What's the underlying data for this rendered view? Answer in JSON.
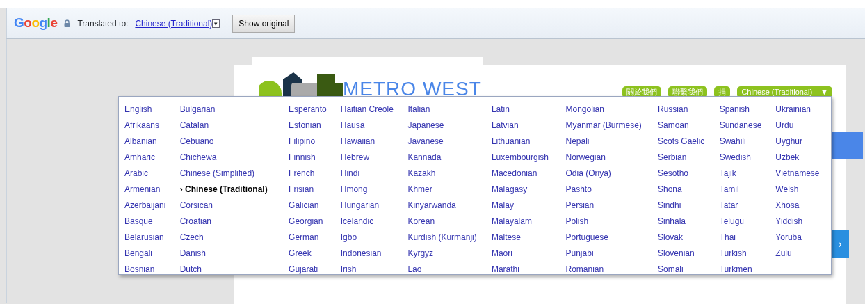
{
  "translate_bar": {
    "brand": "Google",
    "label": "Translated to:",
    "language": "Chinese (Traditional)",
    "dropdown_glyph": "▾",
    "button": "Show original"
  },
  "site": {
    "logo_text": "METRO WEST",
    "nav": [
      {
        "label": "關於我們"
      },
      {
        "label": "聯繫我們"
      },
      {
        "label": "捐"
      }
    ],
    "language_button": {
      "label": "Chinese (Traditional)",
      "glyph": "▼"
    },
    "next_glyph": "›"
  },
  "language_menu": {
    "marker": "›",
    "columns": [
      [
        {
          "label": "English",
          "selected": false
        },
        {
          "label": "Afrikaans",
          "selected": false
        },
        {
          "label": "Albanian",
          "selected": false
        },
        {
          "label": "Amharic",
          "selected": false
        },
        {
          "label": "Arabic",
          "selected": false
        },
        {
          "label": "Armenian",
          "selected": false
        },
        {
          "label": "Azerbaijani",
          "selected": false
        },
        {
          "label": "Basque",
          "selected": false
        },
        {
          "label": "Belarusian",
          "selected": false
        },
        {
          "label": "Bengali",
          "selected": false
        },
        {
          "label": "Bosnian",
          "selected": false
        }
      ],
      [
        {
          "label": "Bulgarian",
          "selected": false
        },
        {
          "label": "Catalan",
          "selected": false
        },
        {
          "label": "Cebuano",
          "selected": false
        },
        {
          "label": "Chichewa",
          "selected": false
        },
        {
          "label": "Chinese (Simplified)",
          "selected": false
        },
        {
          "label": "Chinese (Traditional)",
          "selected": true
        },
        {
          "label": "Corsican",
          "selected": false
        },
        {
          "label": "Croatian",
          "selected": false
        },
        {
          "label": "Czech",
          "selected": false
        },
        {
          "label": "Danish",
          "selected": false
        },
        {
          "label": "Dutch",
          "selected": false
        }
      ],
      [
        {
          "label": "Esperanto",
          "selected": false
        },
        {
          "label": "Estonian",
          "selected": false
        },
        {
          "label": "Filipino",
          "selected": false
        },
        {
          "label": "Finnish",
          "selected": false
        },
        {
          "label": "French",
          "selected": false
        },
        {
          "label": "Frisian",
          "selected": false
        },
        {
          "label": "Galician",
          "selected": false
        },
        {
          "label": "Georgian",
          "selected": false
        },
        {
          "label": "German",
          "selected": false
        },
        {
          "label": "Greek",
          "selected": false
        },
        {
          "label": "Gujarati",
          "selected": false
        }
      ],
      [
        {
          "label": "Haitian Creole",
          "selected": false
        },
        {
          "label": "Hausa",
          "selected": false
        },
        {
          "label": "Hawaiian",
          "selected": false
        },
        {
          "label": "Hebrew",
          "selected": false
        },
        {
          "label": "Hindi",
          "selected": false
        },
        {
          "label": "Hmong",
          "selected": false
        },
        {
          "label": "Hungarian",
          "selected": false
        },
        {
          "label": "Icelandic",
          "selected": false
        },
        {
          "label": "Igbo",
          "selected": false
        },
        {
          "label": "Indonesian",
          "selected": false
        },
        {
          "label": "Irish",
          "selected": false
        }
      ],
      [
        {
          "label": "Italian",
          "selected": false
        },
        {
          "label": "Japanese",
          "selected": false
        },
        {
          "label": "Javanese",
          "selected": false
        },
        {
          "label": "Kannada",
          "selected": false
        },
        {
          "label": "Kazakh",
          "selected": false
        },
        {
          "label": "Khmer",
          "selected": false
        },
        {
          "label": "Kinyarwanda",
          "selected": false
        },
        {
          "label": "Korean",
          "selected": false
        },
        {
          "label": "Kurdish (Kurmanji)",
          "selected": false
        },
        {
          "label": "Kyrgyz",
          "selected": false
        },
        {
          "label": "Lao",
          "selected": false
        }
      ],
      [
        {
          "label": "Latin",
          "selected": false
        },
        {
          "label": "Latvian",
          "selected": false
        },
        {
          "label": "Lithuanian",
          "selected": false
        },
        {
          "label": "Luxembourgish",
          "selected": false
        },
        {
          "label": "Macedonian",
          "selected": false
        },
        {
          "label": "Malagasy",
          "selected": false
        },
        {
          "label": "Malay",
          "selected": false
        },
        {
          "label": "Malayalam",
          "selected": false
        },
        {
          "label": "Maltese",
          "selected": false
        },
        {
          "label": "Maori",
          "selected": false
        },
        {
          "label": "Marathi",
          "selected": false
        }
      ],
      [
        {
          "label": "Mongolian",
          "selected": false
        },
        {
          "label": "Myanmar (Burmese)",
          "selected": false
        },
        {
          "label": "Nepali",
          "selected": false
        },
        {
          "label": "Norwegian",
          "selected": false
        },
        {
          "label": "Odia (Oriya)",
          "selected": false
        },
        {
          "label": "Pashto",
          "selected": false
        },
        {
          "label": "Persian",
          "selected": false
        },
        {
          "label": "Polish",
          "selected": false
        },
        {
          "label": "Portuguese",
          "selected": false
        },
        {
          "label": "Punjabi",
          "selected": false
        },
        {
          "label": "Romanian",
          "selected": false
        }
      ],
      [
        {
          "label": "Russian",
          "selected": false
        },
        {
          "label": "Samoan",
          "selected": false
        },
        {
          "label": "Scots Gaelic",
          "selected": false
        },
        {
          "label": "Serbian",
          "selected": false
        },
        {
          "label": "Sesotho",
          "selected": false
        },
        {
          "label": "Shona",
          "selected": false
        },
        {
          "label": "Sindhi",
          "selected": false
        },
        {
          "label": "Sinhala",
          "selected": false
        },
        {
          "label": "Slovak",
          "selected": false
        },
        {
          "label": "Slovenian",
          "selected": false
        },
        {
          "label": "Somali",
          "selected": false
        }
      ],
      [
        {
          "label": "Spanish",
          "selected": false
        },
        {
          "label": "Sundanese",
          "selected": false
        },
        {
          "label": "Swahili",
          "selected": false
        },
        {
          "label": "Swedish",
          "selected": false
        },
        {
          "label": "Tajik",
          "selected": false
        },
        {
          "label": "Tamil",
          "selected": false
        },
        {
          "label": "Tatar",
          "selected": false
        },
        {
          "label": "Telugu",
          "selected": false
        },
        {
          "label": "Thai",
          "selected": false
        },
        {
          "label": "Turkish",
          "selected": false
        },
        {
          "label": "Turkmen",
          "selected": false
        }
      ],
      [
        {
          "label": "Ukrainian",
          "selected": false
        },
        {
          "label": "Urdu",
          "selected": false
        },
        {
          "label": "Uyghur",
          "selected": false
        },
        {
          "label": "Uzbek",
          "selected": false
        },
        {
          "label": "Vietnamese",
          "selected": false
        },
        {
          "label": "Welsh",
          "selected": false
        },
        {
          "label": "Xhosa",
          "selected": false
        },
        {
          "label": "Yiddish",
          "selected": false
        },
        {
          "label": "Yoruba",
          "selected": false
        },
        {
          "label": "Zulu",
          "selected": false
        }
      ]
    ]
  }
}
